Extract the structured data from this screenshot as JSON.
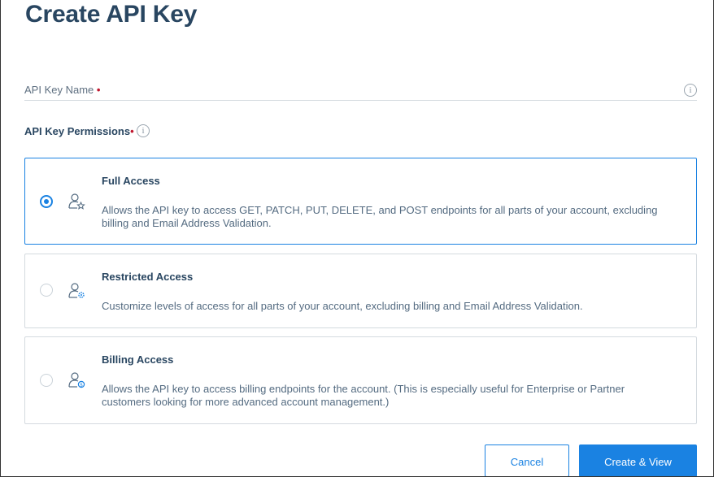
{
  "page": {
    "title": "Create API Key"
  },
  "form": {
    "name_label": "API Key Name",
    "required_mark": "•",
    "permissions_heading": "API Key Permissions",
    "permissions_required_mark": "•",
    "info_glyph": "i"
  },
  "options": [
    {
      "title": "Full Access",
      "description": "Allows the API key to access GET, PATCH, PUT, DELETE, and POST endpoints for all parts of your account, excluding billing and Email Address Validation.",
      "selected": true,
      "icon": "user-star-icon"
    },
    {
      "title": "Restricted Access",
      "description": "Customize levels of access for all parts of your account, excluding billing and Email Address Validation.",
      "selected": false,
      "icon": "user-gear-icon"
    },
    {
      "title": "Billing Access",
      "description": "Allows the API key to access billing endpoints for the account. (This is especially useful for Enterprise or Partner customers looking for more advanced account management.)",
      "selected": false,
      "icon": "user-dollar-icon"
    }
  ],
  "actions": {
    "cancel_label": "Cancel",
    "create_label": "Create & View"
  },
  "colors": {
    "accent": "#1a82e2",
    "heading": "#294661",
    "required": "#c0172e"
  }
}
